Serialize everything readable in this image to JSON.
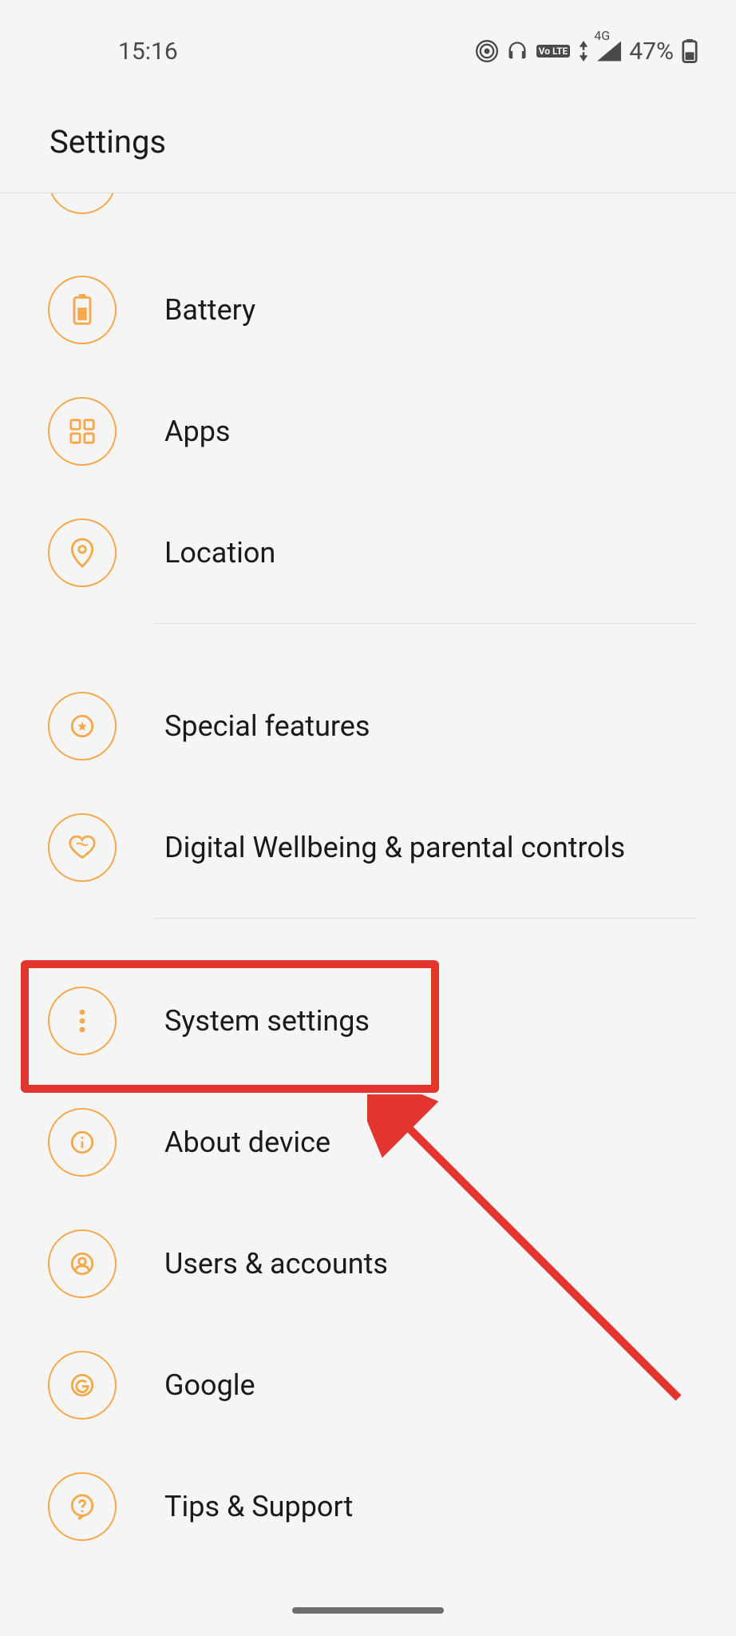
{
  "status": {
    "time": "15:16",
    "network_badge": "Vo LTE",
    "signal_label": "4G",
    "battery_pct": "47%"
  },
  "header": {
    "title": "Settings"
  },
  "items": {
    "battery": {
      "label": "Battery"
    },
    "apps": {
      "label": "Apps"
    },
    "location": {
      "label": "Location"
    },
    "special": {
      "label": "Special features"
    },
    "wellbeing": {
      "label": "Digital Wellbeing & parental controls"
    },
    "system": {
      "label": "System settings"
    },
    "about": {
      "label": "About device"
    },
    "users": {
      "label": "Users & accounts"
    },
    "google": {
      "label": "Google"
    },
    "tips": {
      "label": "Tips & Support"
    }
  },
  "colors": {
    "accent": "#f5a94c",
    "icon_fill": "#f5a94c",
    "highlight": "#e3352e"
  },
  "annotation": {
    "highlighted_item": "system"
  }
}
